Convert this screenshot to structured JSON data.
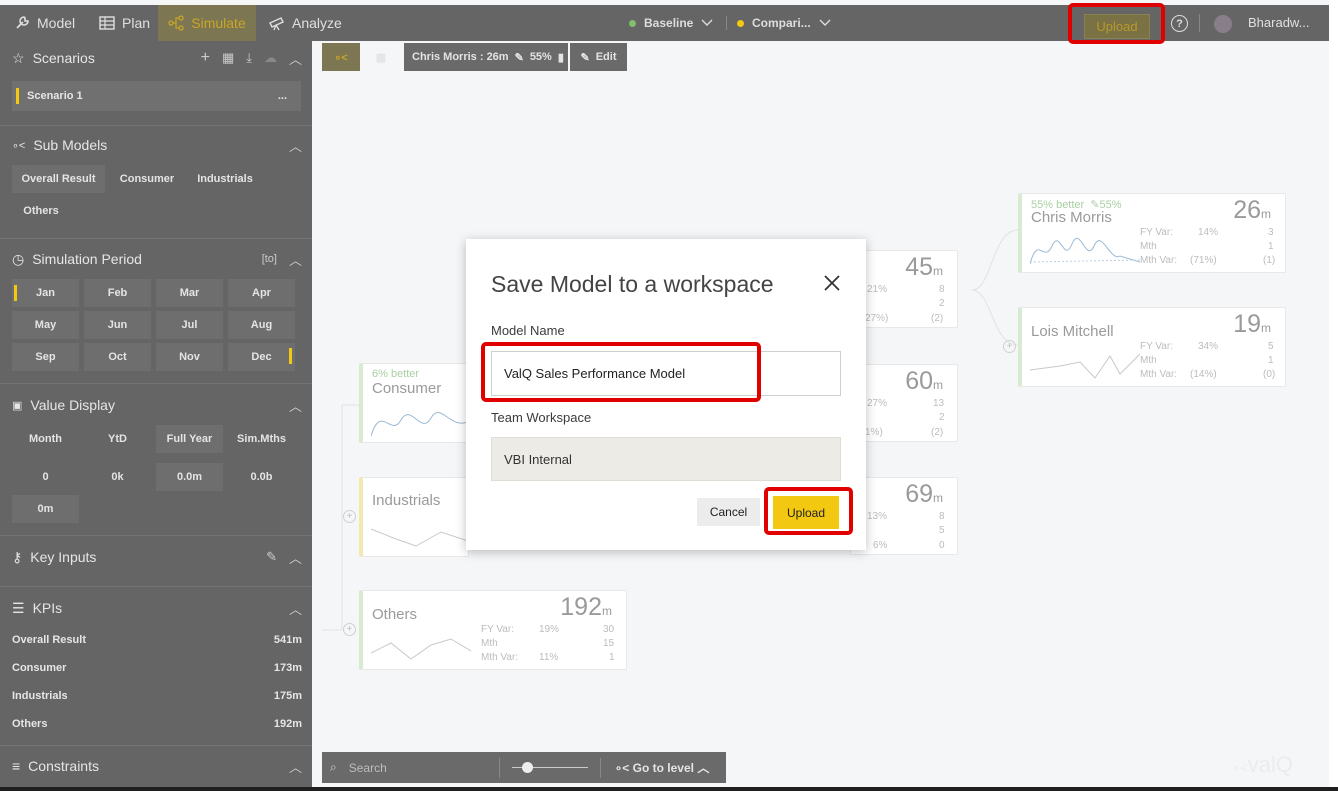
{
  "nav": {
    "model": "Model",
    "plan": "Plan",
    "simulate": "Simulate",
    "analyze": "Analyze",
    "baseline": "Baseline",
    "comparison": "Compari...",
    "upload": "Upload",
    "user": "Bharadw...",
    "colors": {
      "baseline_dot": "#7fbf6e",
      "comparison_dot": "#f2c811",
      "accent": "#f2c811"
    }
  },
  "sidebar": {
    "scenarios": {
      "title": "Scenarios",
      "items": [
        {
          "label": "Scenario 1",
          "menu": "..."
        }
      ]
    },
    "submodels": {
      "title": "Sub Models",
      "items": [
        "Overall Result",
        "Consumer",
        "Industrials",
        "Others"
      ]
    },
    "period": {
      "title": "Simulation Period",
      "badge": "[to]",
      "months": [
        "Jan",
        "Feb",
        "Mar",
        "Apr",
        "May",
        "Jun",
        "Jul",
        "Aug",
        "Sep",
        "Oct",
        "Nov",
        "Dec"
      ]
    },
    "value_display": {
      "title": "Value Display",
      "modes": [
        "Month",
        "YtD",
        "Full Year",
        "Sim.Mths"
      ],
      "formats": [
        "0",
        "0k",
        "0.0m",
        "0.0b",
        "0m"
      ]
    },
    "key_inputs": {
      "title": "Key Inputs"
    },
    "kpis": {
      "title": "KPIs",
      "rows": [
        {
          "label": "Overall Result",
          "value": "541m"
        },
        {
          "label": "Consumer",
          "value": "173m"
        },
        {
          "label": "Industrials",
          "value": "175m"
        },
        {
          "label": "Others",
          "value": "192m"
        }
      ]
    },
    "constraints": {
      "title": "Constraints"
    }
  },
  "toolbar": {
    "node_info": "Chris Morris : 26m",
    "pct": "55%",
    "edit": "Edit"
  },
  "tree": {
    "consumer": {
      "better": "6% better",
      "name": "Consumer"
    },
    "industrials": {
      "name": "Industrials"
    },
    "others": {
      "name": "Others",
      "value": "192",
      "unit": "m",
      "fy_var_label": "FY Var:",
      "fy_var": "19%",
      "fy_num": "30",
      "mth_label": "Mth",
      "mth_num": "15",
      "mth_var_label": "Mth Var:",
      "mth_var": "11%",
      "mth_var_num": "1"
    },
    "mid1": {
      "value": "45",
      "unit": "m",
      "a": "21%",
      "b": "8",
      "c": "2",
      "d": "27%)",
      "e": "(2)"
    },
    "mid2": {
      "value": "60",
      "unit": "m",
      "a": "27%",
      "b": "13",
      "c": "2",
      "d": "1%)",
      "e": "(2)"
    },
    "mid3": {
      "value": "69",
      "unit": "m",
      "a": "13%",
      "b": "8",
      "c": "5",
      "d": "6%",
      "e": "0"
    },
    "chris": {
      "better": "55% better",
      "pct": "55%",
      "name": "Chris Morris",
      "value": "26",
      "unit": "m",
      "fy_var_label": "FY Var:",
      "fy_var": "14%",
      "fy_num": "3",
      "mth_label": "Mth",
      "mth_num": "1",
      "mth_var_label": "Mth Var:",
      "mth_var": "(71%)",
      "mth_var_num": "(1)"
    },
    "lois": {
      "name": "Lois Mitchell",
      "value": "19",
      "unit": "m",
      "fy_var_label": "FY Var:",
      "fy_var": "34%",
      "fy_num": "5",
      "mth_label": "Mth",
      "mth_num": "1",
      "mth_var_label": "Mth Var:",
      "mth_var": "(14%)",
      "mth_var_num": "(0)"
    }
  },
  "bottombar": {
    "search_placeholder": "Search",
    "goto": "Go to level"
  },
  "dialog": {
    "title": "Save Model to a workspace",
    "model_name_label": "Model Name",
    "model_name_value": "ValQ Sales Performance Model",
    "team_workspace_label": "Team Workspace",
    "team_workspace_value": "VBI Internal",
    "cancel": "Cancel",
    "upload": "Upload"
  },
  "watermark": "valQ"
}
